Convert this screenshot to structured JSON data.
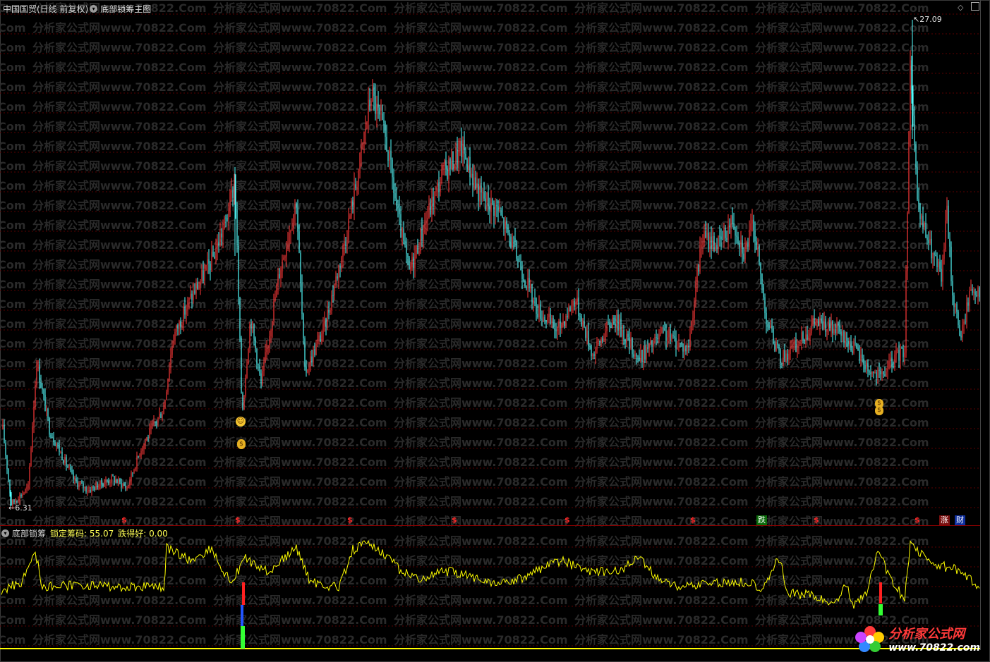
{
  "main_header": {
    "stock": "中国国贸(日线 前复权)",
    "indicator": "底部锁筹主图"
  },
  "sub_header": {
    "indicator": "底部锁筹",
    "lock_label": "锁定筹码: 55.07",
    "fall_label": "跌得好: 0.00"
  },
  "price": {
    "high_label": "27.09",
    "low_label": "6.31",
    "high": 27.09,
    "low": 6.31
  },
  "watermark": "分析家公式网www.70822.Com",
  "markers": {
    "s": "$",
    "die": "跌",
    "zhang": "涨",
    "cai": "财"
  },
  "logo": {
    "name": "分析家公式网",
    "url": "www.70822.com"
  },
  "colors": {
    "up": "#ff3a3a",
    "down": "#54ffff",
    "lock_line": "#ffff00",
    "grid": "#5a0000"
  }
}
